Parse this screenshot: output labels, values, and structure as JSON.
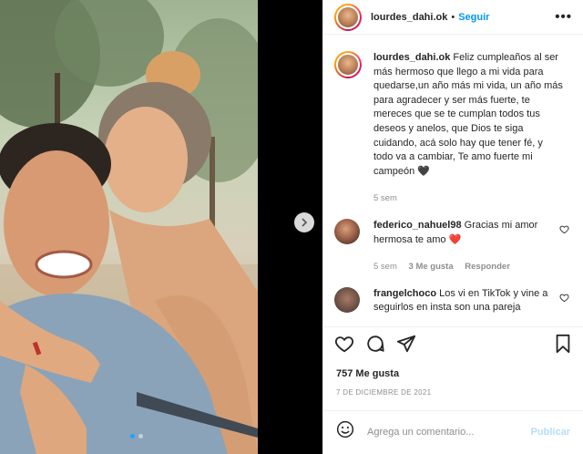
{
  "header": {
    "username": "lourdes_dahi.ok",
    "separator": "•",
    "follow_label": "Seguir",
    "more_icon": "more-horizontal-icon"
  },
  "caption": {
    "username": "lourdes_dahi.ok",
    "text": "Feliz cumpleaños al ser más hermoso que llego a mi vida para quedarse,un año más mi vida, un año más para agradecer y ser más fuerte, te mereces que se te cumplan todos tus deseos y anelos, que Dios te siga cuidando, acá solo hay que tener fé, y todo va a cambiar, Te amo fuerte mi campeón 🖤",
    "time": "5 sem"
  },
  "comments": [
    {
      "username": "federico_nahuel98",
      "text": "Gracias mi amor hermosa te amo ❤️",
      "time": "5 sem",
      "likes": "3 Me gusta",
      "reply_label": "Responder"
    },
    {
      "username": "frangelchoco",
      "text": "Los vi en TikTok y vine a seguirlos en insta son una pareja"
    }
  ],
  "post": {
    "likes": "757 Me gusta",
    "date": "7 DE DICIEMBRE DE 2021"
  },
  "add_comment": {
    "placeholder": "Agrega un comentario...",
    "publish_label": "Publicar"
  },
  "carousel": {
    "slide_count": 2,
    "active_index": 0
  },
  "colors": {
    "accent": "#0095f6",
    "muted": "#8e8e8e",
    "text": "#262626",
    "publish_disabled": "#b2dffc"
  }
}
